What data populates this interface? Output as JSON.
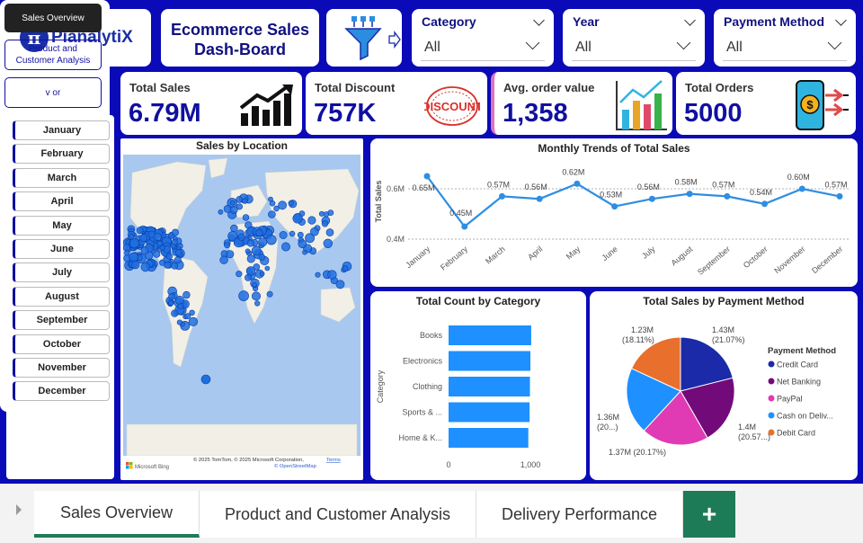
{
  "header": {
    "logo_symbol": "π",
    "logo_text": "PianalytiX",
    "title_line1": "Ecommerce Sales",
    "title_line2": "Dash-Board",
    "funnel_icon": "filter-funnel-icon"
  },
  "slicers": [
    {
      "label": "Category",
      "value": "All"
    },
    {
      "label": "Year",
      "value": "All"
    },
    {
      "label": "Payment Method",
      "value": "All"
    }
  ],
  "nav": {
    "sales_overview": "Sales Overview",
    "product_customer": "Product and Customer Analysis",
    "delivery_partial": "v         or"
  },
  "months": [
    "January",
    "February",
    "March",
    "April",
    "May",
    "June",
    "July",
    "August",
    "September",
    "October",
    "November",
    "December"
  ],
  "kpis": [
    {
      "label": "Total Sales",
      "value": "6.79M",
      "icon": "growth-chart-icon"
    },
    {
      "label": "Total Discount",
      "value": "757K",
      "icon": "discount-stamp-icon",
      "stamp_text": "DISCOUNT"
    },
    {
      "label": "Avg. order value",
      "value": "1,358",
      "icon": "bar-chart-icon"
    },
    {
      "label": "Total Orders",
      "value": "5000",
      "icon": "mobile-payment-icon"
    }
  ],
  "map": {
    "title": "Sales by Location",
    "brand": "Microsoft Bing",
    "attribution": "© 2025 TomTom, © 2025 Microsoft Corporation,",
    "terms": "Terms",
    "osm": "© OpenStreetMap"
  },
  "line_chart": {
    "title": "Monthly Trends of Total Sales",
    "ylabel": "Total Sales",
    "yticks": [
      "0.6M",
      "0.4M"
    ]
  },
  "bar_chart": {
    "title": "Total Count by Category",
    "ylabel": "Category",
    "xticks": [
      "0",
      "1,000"
    ]
  },
  "pie_chart": {
    "title": "Total Sales by Payment Method",
    "legend_title": "Payment Method",
    "labels": [
      {
        "l1": "1.43M",
        "l2": "(21.07%)"
      },
      {
        "l1": "1.4M",
        "l2": "(20.57...)"
      },
      {
        "l1": "1.37M (20.17%)",
        "l2": ""
      },
      {
        "l1": "1.36M",
        "l2": "(20...)"
      },
      {
        "l1": "1.23M",
        "l2": "(18.11%)"
      }
    ]
  },
  "chart_data": [
    {
      "type": "line",
      "title": "Monthly Trends of Total Sales",
      "ylabel": "Total Sales",
      "categories": [
        "January",
        "February",
        "March",
        "April",
        "May",
        "June",
        "July",
        "August",
        "September",
        "October",
        "November",
        "December"
      ],
      "values": [
        0.65,
        0.45,
        0.57,
        0.56,
        0.62,
        0.53,
        0.56,
        0.58,
        0.57,
        0.54,
        0.6,
        0.57
      ],
      "data_labels": [
        "0.65M",
        "0.45M",
        "0.57M",
        "0.56M",
        "0.62M",
        "0.53M",
        "0.56M",
        "0.58M",
        "0.57M",
        "0.54M",
        "0.60M",
        "0.57M"
      ],
      "ylim": [
        0.4,
        0.7
      ],
      "color": "#2f8ee0"
    },
    {
      "type": "bar",
      "title": "Total Count by Category",
      "ylabel": "Category",
      "categories": [
        "Books",
        "Electronics",
        "Clothing",
        "Sports & ...",
        "Home & K..."
      ],
      "values": [
        1010,
        1000,
        995,
        990,
        975
      ],
      "xlim": [
        0,
        1000
      ],
      "color": "#1e90ff"
    },
    {
      "type": "pie",
      "title": "Total Sales by Payment Method",
      "legend_title": "Payment Method",
      "categories": [
        "Credit Card",
        "Net Banking",
        "PayPal",
        "Cash on Deliv...",
        "Debit Card"
      ],
      "values": [
        1.43,
        1.4,
        1.37,
        1.36,
        1.23
      ],
      "percents": [
        21.07,
        20.57,
        20.17,
        20.08,
        18.11
      ],
      "colors": [
        "#1a2aa8",
        "#730a7a",
        "#e03ab5",
        "#1e90ff",
        "#e86f2c"
      ]
    }
  ],
  "tabs": [
    {
      "label": "Sales Overview",
      "active": true
    },
    {
      "label": "Product and Customer Analysis",
      "active": false
    },
    {
      "label": "Delivery Performance",
      "active": false
    }
  ],
  "add_tab_symbol": "+"
}
